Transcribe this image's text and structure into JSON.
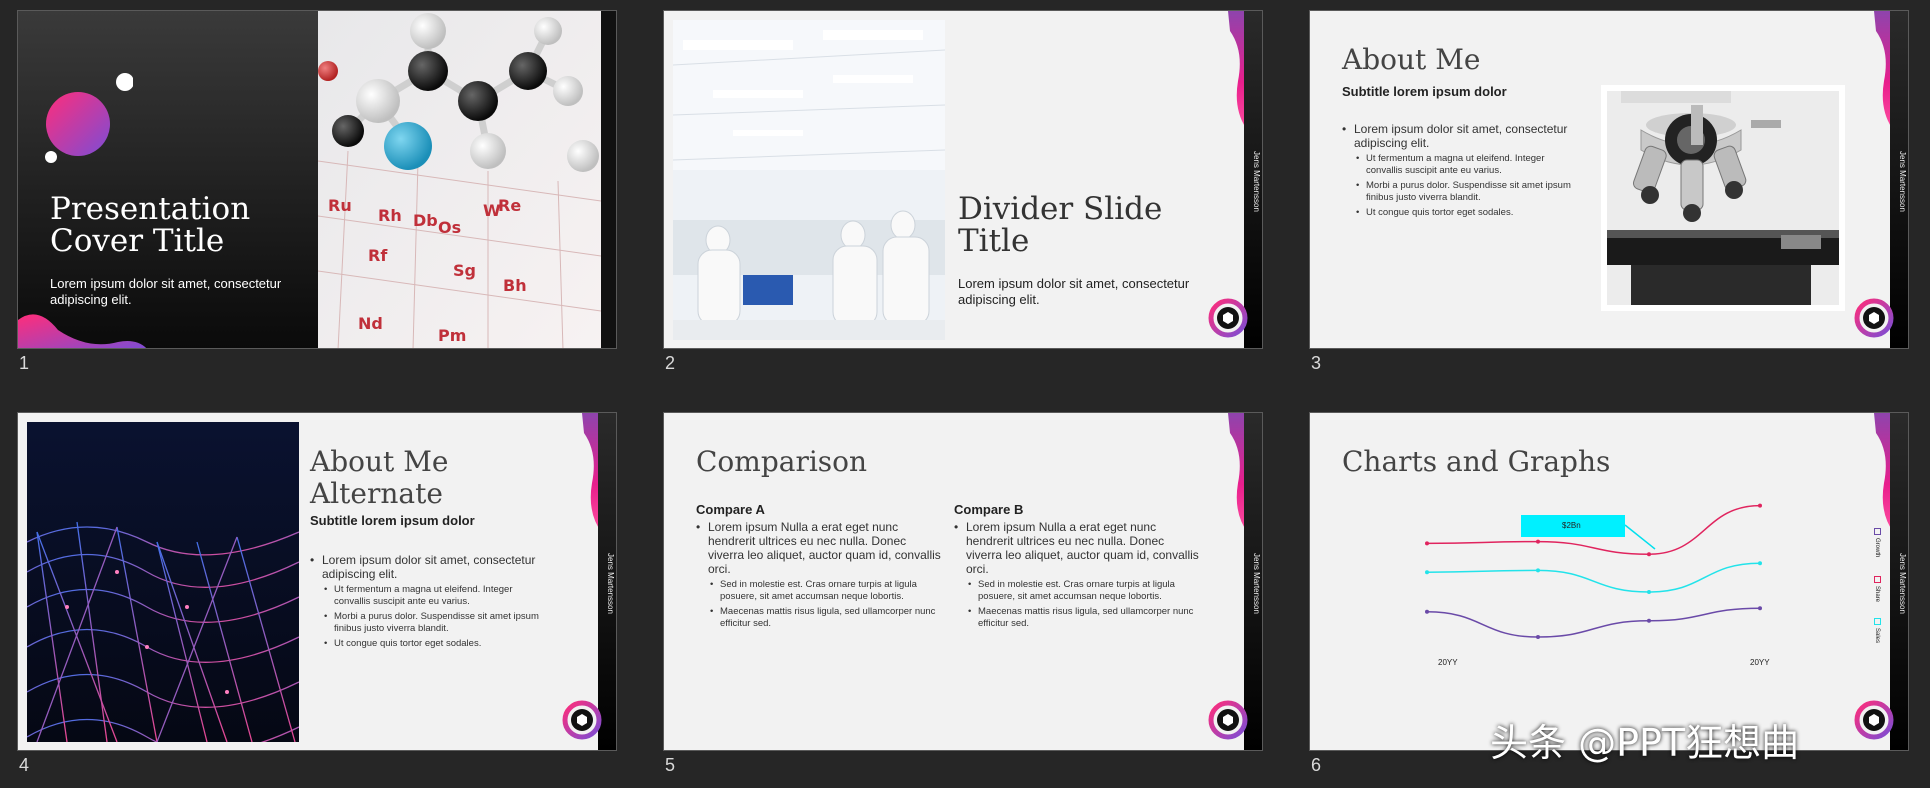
{
  "slides": [
    {
      "number": "1",
      "title": "Presentation Cover Title",
      "body": "Lorem ipsum dolor sit amet, consectetur adipiscing elit."
    },
    {
      "number": "2",
      "title": "Divider Slide Title",
      "body": "Lorem ipsum dolor sit amet, consectetur adipiscing elit.",
      "sidebar": "Jens Martensson"
    },
    {
      "number": "3",
      "title": "About Me",
      "subtitle": "Subtitle lorem ipsum dolor",
      "sidebar": "Jens Martensson",
      "bullet": "Lorem ipsum dolor sit amet, consectetur adipiscing elit.",
      "sub_bullets": [
        "Ut fermentum a magna ut eleifend. Integer convallis suscipit ante eu varius.",
        "Morbi a purus dolor. Suspendisse sit amet ipsum finibus justo viverra blandit.",
        "Ut congue quis tortor eget sodales."
      ]
    },
    {
      "number": "4",
      "title": "About Me Alternate",
      "subtitle": "Subtitle lorem ipsum dolor",
      "sidebar": "Jens Martensson",
      "bullet": "Lorem ipsum dolor sit amet, consectetur adipiscing elit.",
      "sub_bullets": [
        "Ut fermentum a magna ut eleifend. Integer convallis suscipit ante eu varius.",
        "Morbi a purus dolor. Suspendisse sit amet ipsum finibus justo viverra blandit.",
        "Ut congue quis tortor eget sodales."
      ]
    },
    {
      "number": "5",
      "title": "Comparison",
      "sidebar": "Jens Martensson",
      "col_a": {
        "heading": "Compare A",
        "bullet": "Lorem ipsum Nulla a erat eget nunc hendrerit ultrices eu nec nulla. Donec viverra leo aliquet, auctor quam id, convallis orci.",
        "sub_bullets": [
          "Sed in molestie est. Cras ornare turpis at ligula posuere, sit amet accumsan neque lobortis.",
          "Maecenas mattis risus ligula, sed ullamcorper nunc efficitur sed."
        ]
      },
      "col_b": {
        "heading": "Compare B",
        "bullet": "Lorem ipsum Nulla a erat eget nunc hendrerit ultrices eu nec nulla. Donec viverra leo aliquet, auctor quam id, convallis orci.",
        "sub_bullets": [
          "Sed in molestie est. Cras ornare turpis at ligula posuere, sit amet accumsan neque lobortis.",
          "Maecenas mattis risus ligula, sed ullamcorper nunc efficitur sed."
        ]
      }
    },
    {
      "number": "6",
      "title": "Charts and Graphs",
      "sidebar": "Jens Martensson"
    }
  ],
  "chart_data": {
    "type": "line",
    "categories": [
      "20YY",
      "",
      "",
      "20YY"
    ],
    "series": [
      {
        "name": "Growth",
        "color": "#e0245e",
        "values": [
          72,
          73,
          66,
          93
        ]
      },
      {
        "name": "Share",
        "color": "#22e3ea",
        "values": [
          56,
          57,
          45,
          61
        ]
      },
      {
        "name": "Sales",
        "color": "#6a4aa8",
        "values": [
          34,
          20,
          29,
          36
        ]
      }
    ],
    "callout": "$2Bn",
    "ylim": [
      0,
      100
    ]
  },
  "watermark": "头条 @PPT狂想曲",
  "colors": {
    "accent_pink": "#e91e8c",
    "accent_purple": "#8e44ad",
    "cyan": "#00f0ff",
    "background": "#262626"
  }
}
